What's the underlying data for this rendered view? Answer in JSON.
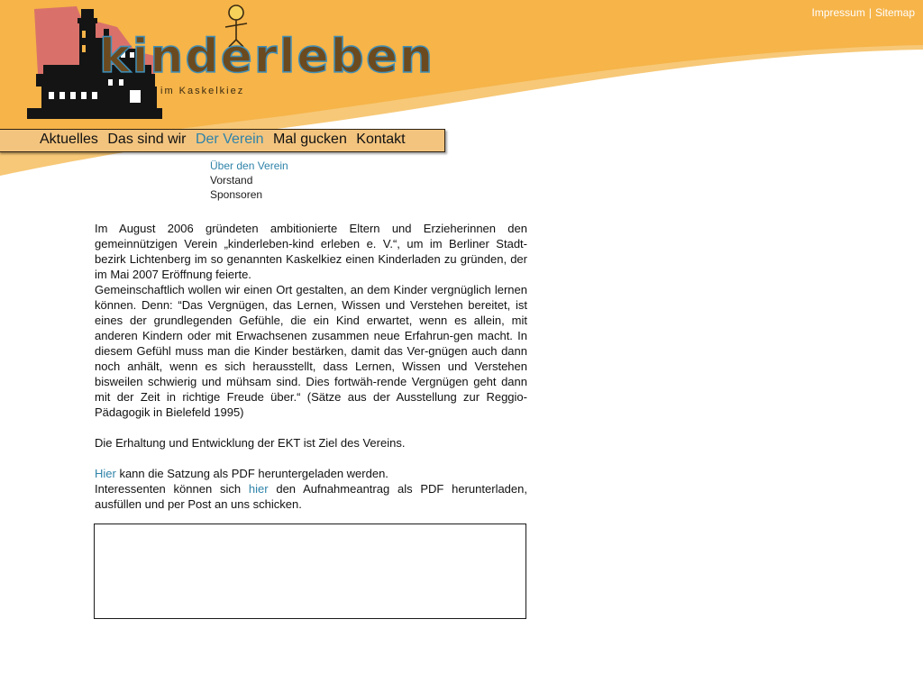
{
  "colors": {
    "header_orange": "#f6b449",
    "header_light": "#f7c26a",
    "nav_bg": "#f3c47e",
    "link_blue": "#2f83a9",
    "logo_pink": "#d9716a",
    "logo_letter_blue": "#3f8fb9",
    "logo_letter_brown": "#6b4a1f"
  },
  "toplinks": {
    "impressum": "Impressum",
    "separator": "|",
    "sitemap": "Sitemap"
  },
  "logo": {
    "title": "kinderleben",
    "subtitle": "im Kaskelkiez",
    "icons": [
      "lighthouse-icon",
      "stick-figure-icon"
    ]
  },
  "nav": {
    "items": [
      {
        "label": "Aktuelles",
        "active": false
      },
      {
        "label": "Das sind wir",
        "active": false
      },
      {
        "label": "Der Verein",
        "active": true
      },
      {
        "label": "Mal gucken",
        "active": false
      },
      {
        "label": "Kontakt",
        "active": false
      }
    ]
  },
  "subnav": {
    "items": [
      {
        "label": "Über den Verein",
        "active": true
      },
      {
        "label": "Vorstand",
        "active": false
      },
      {
        "label": "Sponsoren",
        "active": false
      }
    ]
  },
  "content": {
    "p1": "Im August 2006 gründeten ambitionierte Eltern und Erzieherinnen den gemeinnützigen Verein „kinderleben-kind erleben e. V.“, um im Berliner Stadt-bezirk Lichtenberg im so genannten Kaskelkiez einen Kinderladen zu gründen, der im Mai 2007 Eröffnung feierte.",
    "p2": "Gemeinschaftlich wollen wir einen Ort gestalten, an dem Kinder vergnüglich lernen können. Denn: “Das Vergnügen, das Lernen, Wissen und Verstehen bereitet, ist eines der grundlegenden Gefühle, die ein Kind erwartet, wenn es allein, mit anderen Kindern oder mit Erwachsenen zusammen neue Erfahrun-gen macht. In diesem Gefühl muss man die Kinder bestärken, damit das Ver-gnügen auch dann noch anhält, wenn es sich herausstellt, dass Lernen, Wissen und Verstehen bisweilen schwierig und mühsam sind. Dies fortwäh-rende Vergnügen geht dann mit der Zeit in richtige Freude über.“ (Sätze aus der Ausstellung zur Reggio-Pädagogik in Bielefeld 1995)",
    "p3": "Die Erhaltung und Entwicklung der EKT ist Ziel des Vereins.",
    "p4_link": "Hier",
    "p4_text": " kann die Satzung als PDF heruntergeladen werden.",
    "p5_pre": "Interessenten können sich ",
    "p5_link": "hier",
    "p5_post": " den Aufnahmeantrag als PDF herunterladen, ausfüllen und per Post an uns schicken."
  }
}
